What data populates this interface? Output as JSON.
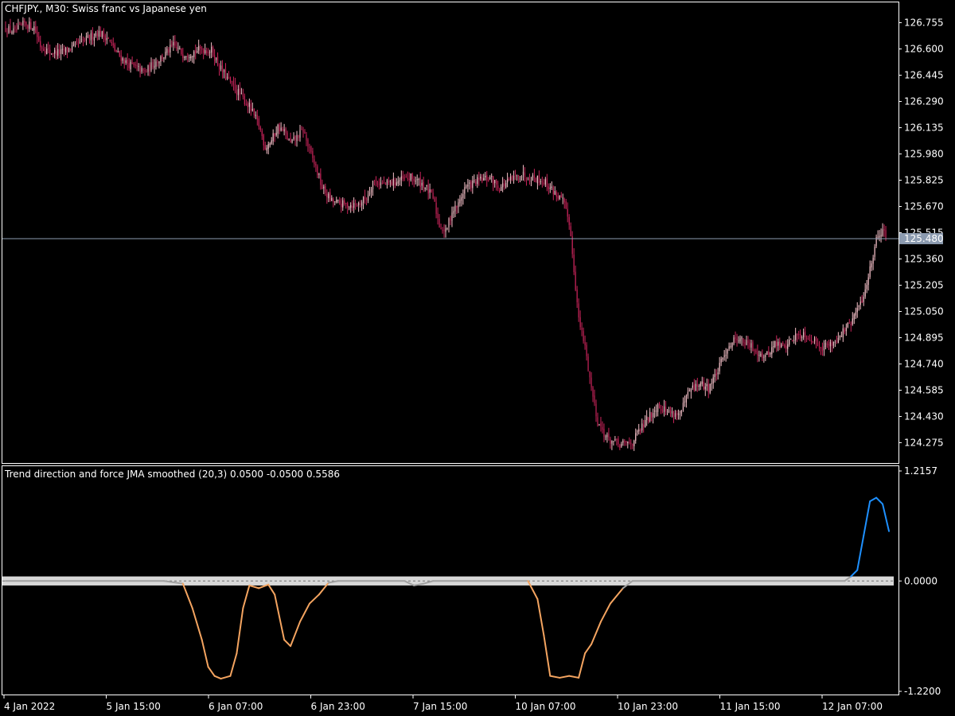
{
  "chart_data": [
    {
      "type": "candlestick",
      "title": "CHFJPY., M30:  Swiss franc vs Japanese yen",
      "y_ticks": [
        "126.755",
        "126.600",
        "126.445",
        "126.290",
        "126.135",
        "125.980",
        "125.825",
        "125.670",
        "125.515",
        "125.360",
        "125.205",
        "125.050",
        "124.895",
        "124.740",
        "124.585",
        "124.430",
        "124.275"
      ],
      "ylim": [
        124.155,
        126.875
      ],
      "current_price": 125.48,
      "current_price_label": "125.480",
      "x_ticks": [
        "4 Jan 2022",
        "5 Jan 15:00",
        "6 Jan 07:00",
        "6 Jan 23:00",
        "7 Jan 15:00",
        "10 Jan 07:00",
        "10 Jan 23:00",
        "11 Jan 15:00",
        "12 Jan 07:00"
      ],
      "bull_color": "#f5c0c8",
      "bear_color": "#c8245a",
      "grid": false,
      "close_path": [
        [
          0,
          126.72
        ],
        [
          6,
          126.7
        ],
        [
          12,
          126.75
        ],
        [
          18,
          126.73
        ],
        [
          22,
          126.62
        ],
        [
          28,
          126.58
        ],
        [
          36,
          126.58
        ],
        [
          44,
          126.62
        ],
        [
          52,
          126.66
        ],
        [
          58,
          126.7
        ],
        [
          64,
          126.67
        ],
        [
          70,
          126.58
        ],
        [
          76,
          126.52
        ],
        [
          82,
          126.49
        ],
        [
          88,
          126.46
        ],
        [
          94,
          126.52
        ],
        [
          100,
          126.56
        ],
        [
          106,
          126.62
        ],
        [
          112,
          126.57
        ],
        [
          118,
          126.58
        ],
        [
          124,
          126.6
        ],
        [
          130,
          126.59
        ],
        [
          136,
          126.48
        ],
        [
          142,
          126.4
        ],
        [
          148,
          126.33
        ],
        [
          154,
          126.26
        ],
        [
          160,
          126.15
        ],
        [
          164,
          126.02
        ],
        [
          168,
          126.06
        ],
        [
          172,
          126.14
        ],
        [
          176,
          126.11
        ],
        [
          180,
          126.04
        ],
        [
          184,
          126.08
        ],
        [
          188,
          126.12
        ],
        [
          192,
          126.0
        ],
        [
          196,
          125.9
        ],
        [
          200,
          125.78
        ],
        [
          206,
          125.7
        ],
        [
          214,
          125.68
        ],
        [
          222,
          125.68
        ],
        [
          228,
          125.72
        ],
        [
          232,
          125.82
        ],
        [
          240,
          125.8
        ],
        [
          248,
          125.82
        ],
        [
          256,
          125.84
        ],
        [
          264,
          125.8
        ],
        [
          270,
          125.72
        ],
        [
          274,
          125.56
        ],
        [
          278,
          125.52
        ],
        [
          282,
          125.64
        ],
        [
          286,
          125.68
        ],
        [
          290,
          125.78
        ],
        [
          298,
          125.82
        ],
        [
          306,
          125.84
        ],
        [
          312,
          125.78
        ],
        [
          318,
          125.82
        ],
        [
          326,
          125.86
        ],
        [
          334,
          125.84
        ],
        [
          340,
          125.82
        ],
        [
          346,
          125.76
        ],
        [
          352,
          125.7
        ],
        [
          356,
          125.58
        ],
        [
          358,
          125.4
        ],
        [
          362,
          125.0
        ],
        [
          366,
          124.84
        ],
        [
          370,
          124.6
        ],
        [
          374,
          124.4
        ],
        [
          380,
          124.3
        ],
        [
          388,
          124.26
        ],
        [
          396,
          124.28
        ],
        [
          400,
          124.34
        ],
        [
          406,
          124.42
        ],
        [
          412,
          124.5
        ],
        [
          418,
          124.46
        ],
        [
          426,
          124.44
        ],
        [
          432,
          124.58
        ],
        [
          438,
          124.62
        ],
        [
          444,
          124.6
        ],
        [
          450,
          124.7
        ],
        [
          456,
          124.84
        ],
        [
          462,
          124.9
        ],
        [
          468,
          124.86
        ],
        [
          474,
          124.82
        ],
        [
          480,
          124.78
        ],
        [
          486,
          124.86
        ],
        [
          492,
          124.84
        ],
        [
          498,
          124.9
        ],
        [
          504,
          124.92
        ],
        [
          510,
          124.88
        ],
        [
          516,
          124.84
        ],
        [
          522,
          124.86
        ],
        [
          528,
          124.92
        ],
        [
          534,
          124.98
        ],
        [
          538,
          125.06
        ],
        [
          542,
          125.14
        ],
        [
          546,
          125.3
        ],
        [
          550,
          125.48
        ],
        [
          554,
          125.54
        ],
        [
          556,
          125.48
        ]
      ]
    },
    {
      "type": "line",
      "title": "Trend direction and force JMA smoothed (20,3) 0.0500 -0.0500 0.5586",
      "y_ticks": [
        "1.2157",
        "0.0000",
        "-1.2200"
      ],
      "ylim": [
        -1.22,
        1.2157
      ],
      "band": [
        -0.05,
        0.05
      ],
      "neutral_color": "#a0a0a0",
      "down_color": "#f4a460",
      "up_color": "#1e90ff",
      "band_color": "#d8d8d8",
      "series": [
        [
          0,
          0
        ],
        [
          100,
          0
        ],
        [
          112,
          -0.03
        ],
        [
          118,
          -0.3
        ],
        [
          124,
          -0.65
        ],
        [
          128,
          -0.95
        ],
        [
          132,
          -1.05
        ],
        [
          136,
          -1.08
        ],
        [
          142,
          -1.05
        ],
        [
          146,
          -0.8
        ],
        [
          150,
          -0.3
        ],
        [
          154,
          -0.05
        ],
        [
          160,
          -0.08
        ],
        [
          166,
          -0.04
        ],
        [
          170,
          -0.15
        ],
        [
          176,
          -0.65
        ],
        [
          180,
          -0.72
        ],
        [
          186,
          -0.45
        ],
        [
          192,
          -0.25
        ],
        [
          198,
          -0.15
        ],
        [
          204,
          -0.02
        ],
        [
          210,
          0
        ],
        [
          252,
          0
        ],
        [
          258,
          -0.05
        ],
        [
          264,
          -0.03
        ],
        [
          270,
          0
        ],
        [
          330,
          0
        ],
        [
          336,
          -0.2
        ],
        [
          340,
          -0.6
        ],
        [
          344,
          -1.05
        ],
        [
          350,
          -1.07
        ],
        [
          356,
          -1.05
        ],
        [
          362,
          -1.07
        ],
        [
          366,
          -0.8
        ],
        [
          370,
          -0.7
        ],
        [
          376,
          -0.45
        ],
        [
          382,
          -0.25
        ],
        [
          390,
          -0.08
        ],
        [
          396,
          0
        ],
        [
          530,
          0
        ],
        [
          534,
          0.05
        ],
        [
          538,
          0.12
        ],
        [
          542,
          0.5
        ],
        [
          546,
          0.88
        ],
        [
          550,
          0.92
        ],
        [
          554,
          0.85
        ],
        [
          558,
          0.55
        ]
      ]
    }
  ]
}
